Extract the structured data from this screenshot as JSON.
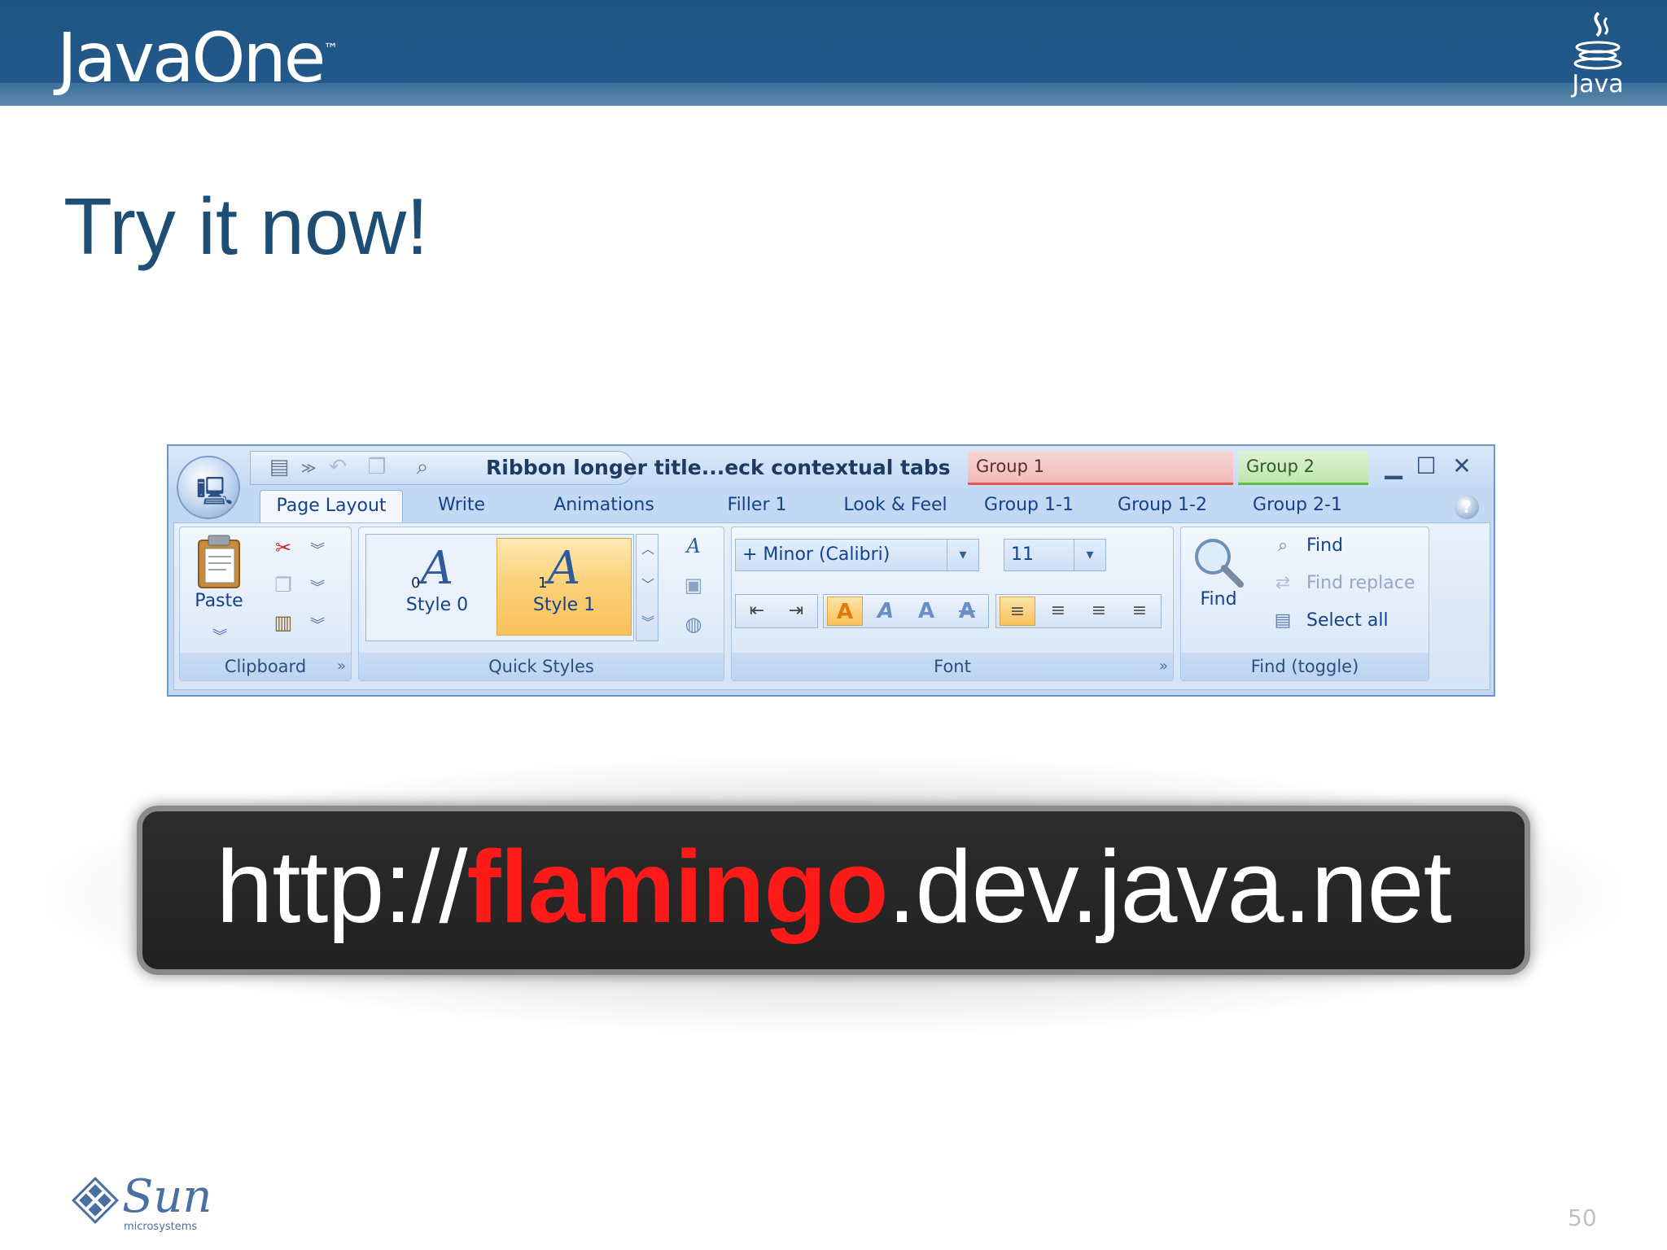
{
  "header": {
    "brand": "JavaOne",
    "brand_tm": "™",
    "java_word": "Java"
  },
  "slide": {
    "title": "Try it now!",
    "page_number": "50"
  },
  "ribbon": {
    "window_title": "Ribbon longer title...eck contextual tabs",
    "contextual_groups": [
      {
        "label": "Group 1",
        "color": "#e05555"
      },
      {
        "label": "Group 2",
        "color": "#5bbf4a"
      }
    ],
    "window_buttons": {
      "minimize": "▁",
      "maximize": "☐",
      "close": "✕"
    },
    "tabs": [
      {
        "label": "Page Layout",
        "active": true
      },
      {
        "label": "Write"
      },
      {
        "label": "Animations"
      },
      {
        "label": "Filler 1"
      },
      {
        "label": "Look & Feel"
      },
      {
        "label": "Group 1-1"
      },
      {
        "label": "Group 1-2"
      },
      {
        "label": "Group 2-1"
      }
    ],
    "help_glyph": "?",
    "bands": {
      "clipboard": {
        "label": "Clipboard",
        "paste_label": "Paste",
        "expand": "»"
      },
      "quick_styles": {
        "label": "Quick Styles",
        "styles": [
          {
            "glyph": "A",
            "index": "0",
            "label": "Style 0",
            "selected": false
          },
          {
            "glyph": "A",
            "index": "1",
            "label": "Style 1",
            "selected": true
          }
        ]
      },
      "font": {
        "label": "Font",
        "font_family": "+ Minor (Calibri)",
        "font_size": "11",
        "expand": "»"
      },
      "find": {
        "label": "Find (toggle)",
        "big_button": "Find",
        "items": [
          {
            "label": "Find",
            "enabled": true
          },
          {
            "label": "Find replace",
            "enabled": false
          },
          {
            "label": "Select all",
            "enabled": true
          }
        ]
      }
    },
    "icons": {
      "app_menu": "app-menu-icon",
      "expand_chevron": "»",
      "dropdown": "▾"
    }
  },
  "url": {
    "prefix": "http://",
    "highlight": "flamingo",
    "suffix": ".dev.java.net",
    "highlight_color": "#ff1a1a"
  },
  "footer": {
    "sun_word": "Sun",
    "sun_sub": "microsystems"
  }
}
